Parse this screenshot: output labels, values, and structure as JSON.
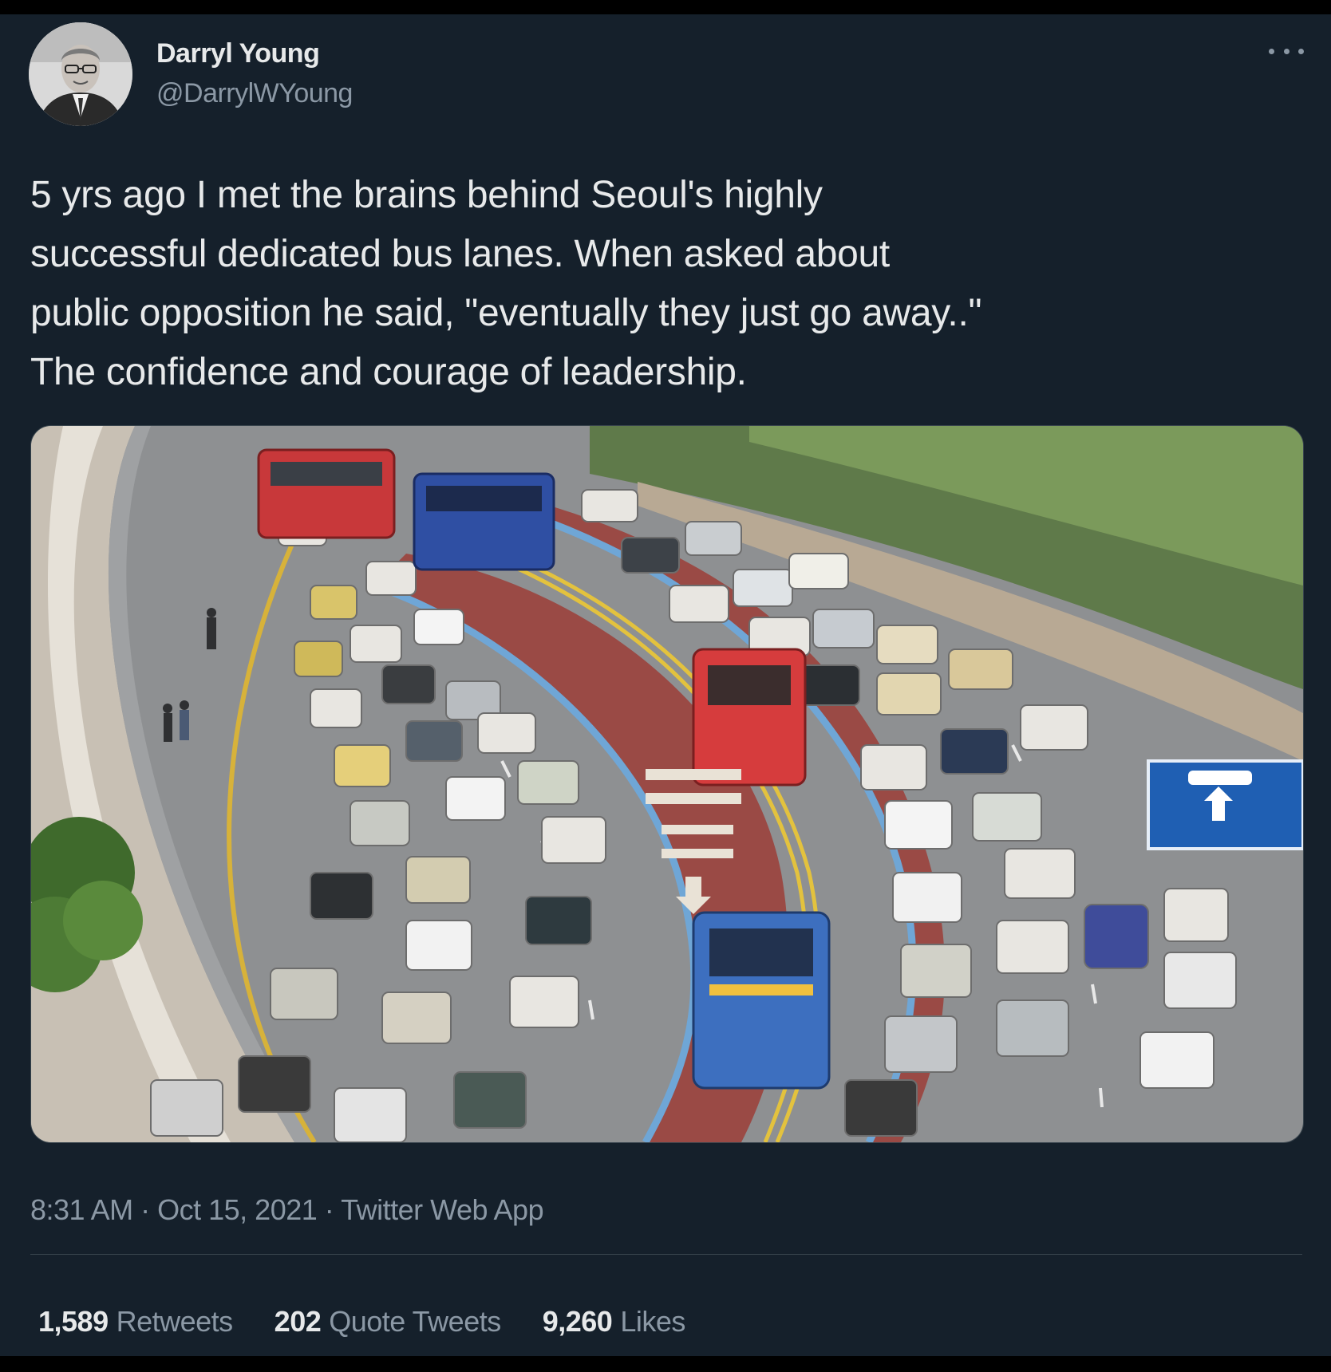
{
  "author": {
    "name": "Darryl Young",
    "handle": "@DarrylWYoung"
  },
  "tweet": {
    "text": "5 yrs ago I met the brains behind Seoul's highly\nsuccessful dedicated bus lanes.  When asked about\npublic opposition he said,  \"eventually they just go away..\"\nThe confidence and courage of leadership.",
    "time": "8:31 AM",
    "date": "Oct 15, 2021",
    "source": "Twitter Web App",
    "separator": "·"
  },
  "stats": {
    "retweets_count": "1,589",
    "retweets_label": "Retweets",
    "quotes_count": "202",
    "quotes_label": "Quote Tweets",
    "likes_count": "9,260",
    "likes_label": "Likes"
  },
  "icons": {
    "more": "more-horizontal-icon"
  },
  "colors": {
    "background": "#15202b",
    "text": "#e7e9ea",
    "secondary": "#8b98a5",
    "bus_lane": "#9a4a45",
    "lane_edge": "#6fa6d6"
  }
}
